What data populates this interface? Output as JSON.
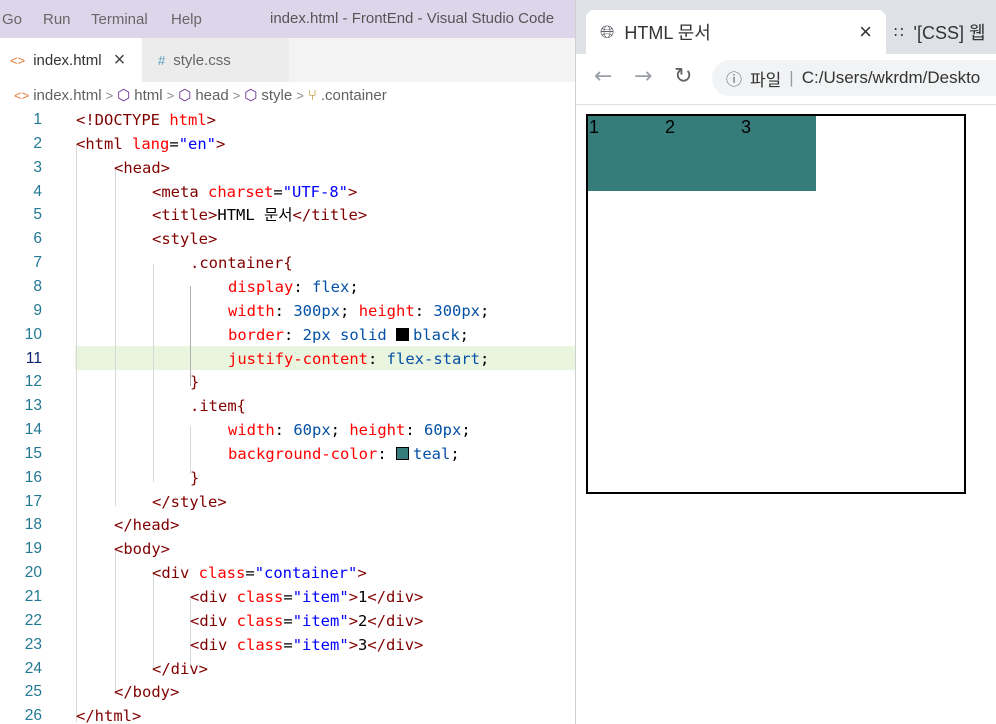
{
  "vscode": {
    "menu": [
      "Go",
      "Run",
      "Terminal",
      "Help"
    ],
    "window_title": "index.html - FrontEnd - Visual Studio Code",
    "tabs": [
      {
        "icon": "<>",
        "label": "index.html",
        "close": "×"
      },
      {
        "icon": "#",
        "label": "style.css"
      }
    ],
    "breadcrumb": [
      "index.html",
      "html",
      "head",
      "style",
      ".container"
    ],
    "active_line": 11,
    "line_numbers": [
      "1",
      "2",
      "3",
      "4",
      "5",
      "6",
      "7",
      "8",
      "9",
      "10",
      "11",
      "12",
      "13",
      "14",
      "15",
      "16",
      "17",
      "18",
      "19",
      "20",
      "21",
      "22",
      "23",
      "24",
      "25",
      "26"
    ],
    "swatch_colors": {
      "black": "#000000",
      "teal": "#367c7a"
    },
    "colors": {
      "line_highlight": "#eaf5df",
      "tag": "#800000",
      "attribute": "#ff0000",
      "string": "#0000ff",
      "value": "#0451a5"
    },
    "code_lines": [
      [
        [
          "punct",
          "<!DOCTYPE "
        ],
        [
          "attr",
          "html"
        ],
        [
          "punct",
          ">"
        ]
      ],
      [
        [
          "punct",
          "<"
        ],
        [
          "tag",
          "html "
        ],
        [
          "attr",
          "lang"
        ],
        [
          "text",
          "="
        ],
        [
          "str",
          "\"en\""
        ],
        [
          "punct",
          ">"
        ]
      ],
      [
        [
          "punct",
          "<"
        ],
        [
          "tag",
          "head"
        ],
        [
          "punct",
          ">"
        ]
      ],
      [
        [
          "punct",
          "<"
        ],
        [
          "tag",
          "meta "
        ],
        [
          "attr",
          "charset"
        ],
        [
          "text",
          "="
        ],
        [
          "str",
          "\"UTF-8\""
        ],
        [
          "punct",
          ">"
        ]
      ],
      [
        [
          "punct",
          "<"
        ],
        [
          "tag",
          "title"
        ],
        [
          "punct",
          ">"
        ],
        [
          "text",
          "HTML 문서"
        ],
        [
          "punct",
          "</"
        ],
        [
          "tag",
          "title"
        ],
        [
          "punct",
          ">"
        ]
      ],
      [
        [
          "punct",
          "<"
        ],
        [
          "tag",
          "style"
        ],
        [
          "punct",
          ">"
        ]
      ],
      [
        [
          "sel",
          ".container{"
        ]
      ],
      [
        [
          "prop",
          "display"
        ],
        [
          "text",
          ": "
        ],
        [
          "val",
          "flex"
        ],
        [
          "text",
          ";"
        ]
      ],
      [
        [
          "prop",
          "width"
        ],
        [
          "text",
          ": "
        ],
        [
          "val",
          "300px"
        ],
        [
          "text",
          "; "
        ],
        [
          "prop",
          "height"
        ],
        [
          "text",
          ": "
        ],
        [
          "val",
          "300px"
        ],
        [
          "text",
          ";"
        ]
      ],
      [
        [
          "prop",
          "border"
        ],
        [
          "text",
          ": "
        ],
        [
          "val",
          "2px solid "
        ],
        [
          "swatch",
          "black"
        ],
        [
          "val",
          "black"
        ],
        [
          "text",
          ";"
        ]
      ],
      [
        [
          "prop",
          "justify-content"
        ],
        [
          "text",
          ": "
        ],
        [
          "val",
          "flex-start"
        ],
        [
          "text",
          ";"
        ]
      ],
      [
        [
          "sel",
          "}"
        ]
      ],
      [
        [
          "sel",
          ".item{"
        ]
      ],
      [
        [
          "prop",
          "width"
        ],
        [
          "text",
          ": "
        ],
        [
          "val",
          "60px"
        ],
        [
          "text",
          "; "
        ],
        [
          "prop",
          "height"
        ],
        [
          "text",
          ": "
        ],
        [
          "val",
          "60px"
        ],
        [
          "text",
          ";"
        ]
      ],
      [
        [
          "prop",
          "background-color"
        ],
        [
          "text",
          ": "
        ],
        [
          "swatch",
          "teal"
        ],
        [
          "val",
          "teal"
        ],
        [
          "text",
          ";"
        ]
      ],
      [
        [
          "sel",
          "}"
        ]
      ],
      [
        [
          "punct",
          "</"
        ],
        [
          "tag",
          "style"
        ],
        [
          "punct",
          ">"
        ]
      ],
      [
        [
          "punct",
          "</"
        ],
        [
          "tag",
          "head"
        ],
        [
          "punct",
          ">"
        ]
      ],
      [
        [
          "punct",
          "<"
        ],
        [
          "tag",
          "body"
        ],
        [
          "punct",
          ">"
        ]
      ],
      [
        [
          "punct",
          "<"
        ],
        [
          "tag",
          "div "
        ],
        [
          "attr",
          "class"
        ],
        [
          "text",
          "="
        ],
        [
          "str",
          "\"container\""
        ],
        [
          "punct",
          ">"
        ]
      ],
      [
        [
          "punct",
          "<"
        ],
        [
          "tag",
          "div "
        ],
        [
          "attr",
          "class"
        ],
        [
          "text",
          "="
        ],
        [
          "str",
          "\"item\""
        ],
        [
          "punct",
          ">"
        ],
        [
          "text",
          "1"
        ],
        [
          "punct",
          "</"
        ],
        [
          "tag",
          "div"
        ],
        [
          "punct",
          ">"
        ]
      ],
      [
        [
          "punct",
          "<"
        ],
        [
          "tag",
          "div "
        ],
        [
          "attr",
          "class"
        ],
        [
          "text",
          "="
        ],
        [
          "str",
          "\"item\""
        ],
        [
          "punct",
          ">"
        ],
        [
          "text",
          "2"
        ],
        [
          "punct",
          "</"
        ],
        [
          "tag",
          "div"
        ],
        [
          "punct",
          ">"
        ]
      ],
      [
        [
          "punct",
          "<"
        ],
        [
          "tag",
          "div "
        ],
        [
          "attr",
          "class"
        ],
        [
          "text",
          "="
        ],
        [
          "str",
          "\"item\""
        ],
        [
          "punct",
          ">"
        ],
        [
          "text",
          "3"
        ],
        [
          "punct",
          "</"
        ],
        [
          "tag",
          "div"
        ],
        [
          "punct",
          ">"
        ]
      ],
      [
        [
          "punct",
          "</"
        ],
        [
          "tag",
          "div"
        ],
        [
          "punct",
          ">"
        ]
      ],
      [
        [
          "punct",
          "</"
        ],
        [
          "tag",
          "body"
        ],
        [
          "punct",
          ">"
        ]
      ],
      [
        [
          "punct",
          "</"
        ],
        [
          "tag",
          "html"
        ],
        [
          "punct",
          ">"
        ]
      ]
    ]
  },
  "browser": {
    "active_tab": {
      "title": "HTML 문서",
      "close": "×"
    },
    "second_tab": {
      "title": "'[CSS] 웹"
    },
    "address": {
      "scheme_label": "파일",
      "url": "C:/Users/wkrdm/Deskto"
    },
    "page_items": [
      "1",
      "2",
      "3"
    ]
  }
}
